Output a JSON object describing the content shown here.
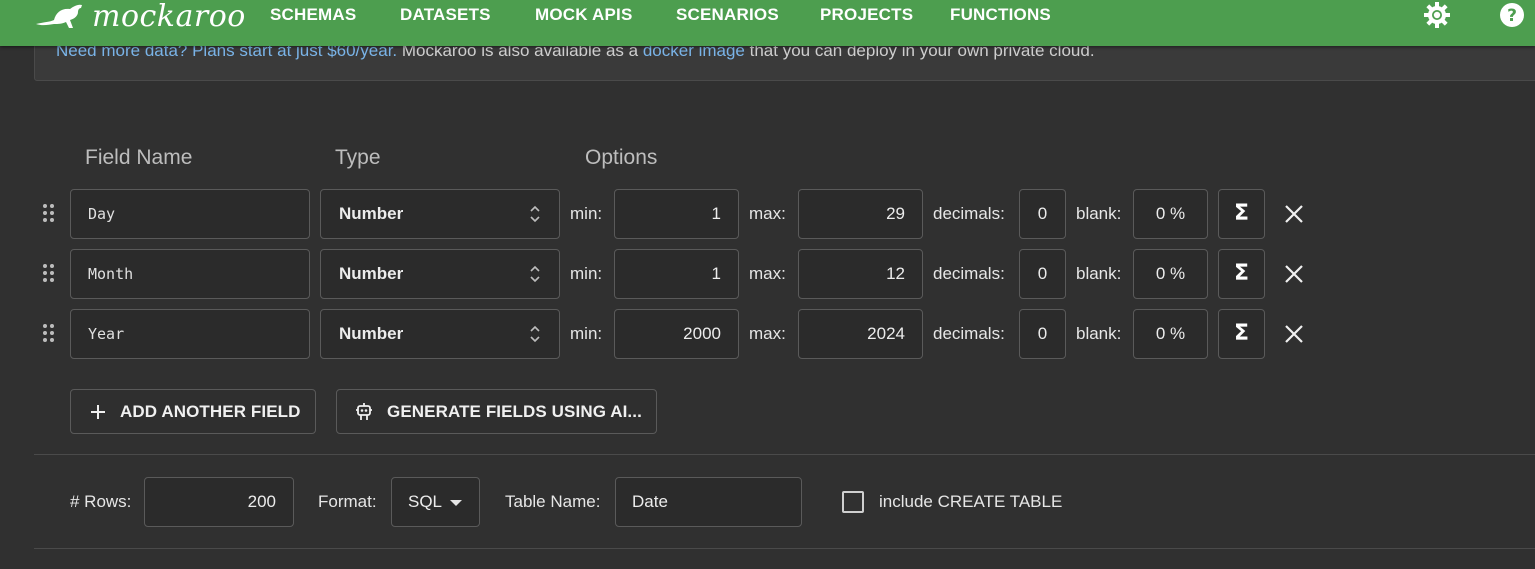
{
  "header": {
    "logo_text": "mockaroo",
    "nav": [
      "SCHEMAS",
      "DATASETS",
      "MOCK APIS",
      "SCENARIOS",
      "PROJECTS",
      "FUNCTIONS"
    ],
    "icons": [
      "theme-icon",
      "help-icon"
    ],
    "brand_color": "#4d9e4f"
  },
  "notice": {
    "link1": "Need more data? Plans start at just $60/year.",
    "text1": " Mockaroo is also available as a ",
    "link2": "docker image",
    "text2": " that you can deploy in your own private cloud."
  },
  "columns": {
    "field_name": "Field Name",
    "type": "Type",
    "options": "Options"
  },
  "option_labels": {
    "min": "min:",
    "max": "max:",
    "decimals": "decimals:",
    "blank": "blank:"
  },
  "fields": [
    {
      "name": "Day",
      "type": "Number",
      "min": "1",
      "max": "29",
      "decimals": "0",
      "blank": "0 %"
    },
    {
      "name": "Month",
      "type": "Number",
      "min": "1",
      "max": "12",
      "decimals": "0",
      "blank": "0 %"
    },
    {
      "name": "Year",
      "type": "Number",
      "min": "2000",
      "max": "2024",
      "decimals": "0",
      "blank": "0 %"
    }
  ],
  "actions": {
    "add_field": "ADD ANOTHER FIELD",
    "generate_ai": "GENERATE FIELDS USING AI..."
  },
  "footer": {
    "rows_label": "# Rows:",
    "rows_value": "200",
    "format_label": "Format:",
    "format_value": "SQL",
    "table_name_label": "Table Name:",
    "table_name_value": "Date",
    "create_table_label": "include CREATE TABLE",
    "create_table_checked": false
  }
}
